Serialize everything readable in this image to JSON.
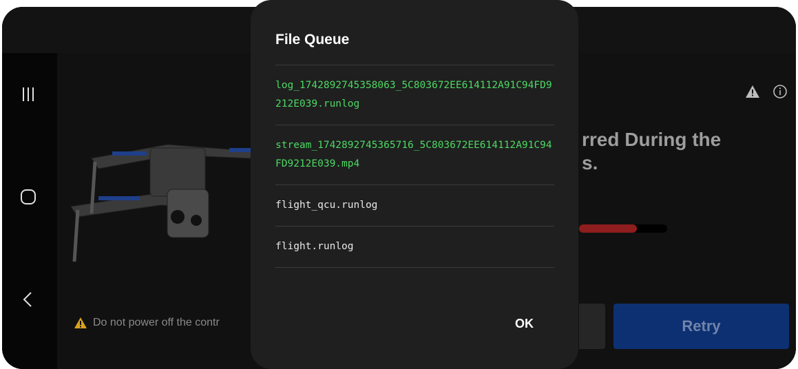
{
  "background_dialog": {
    "headline_line1": "rred During the",
    "headline_line2": "s.",
    "warning_text": "Do not power off the contr",
    "retry_label": "Retry",
    "progress": 0.66
  },
  "modal": {
    "title": "File Queue",
    "files": [
      {
        "name": "log_1742892745358063_5C803672EE614112A91C94FD9212E039.runlog",
        "color": "#4cd964"
      },
      {
        "name": "stream_1742892745365716_5C803672EE614112A91C94FD9212E039.mp4",
        "color": "#4cd964"
      },
      {
        "name": "flight_qcu.runlog",
        "color": "#e8e8e8"
      },
      {
        "name": "flight.runlog",
        "color": "#e8e8e8"
      }
    ],
    "ok_label": "OK"
  },
  "icons": {
    "nav": [
      "recent-apps-icon",
      "home-icon",
      "back-icon"
    ],
    "status": [
      "warning-icon",
      "info-icon"
    ]
  },
  "colors": {
    "accent_green": "#4cd964",
    "retry_blue": "#0d3072",
    "progress_red": "#8e1d1d",
    "modal_bg": "#1f1f1f"
  }
}
